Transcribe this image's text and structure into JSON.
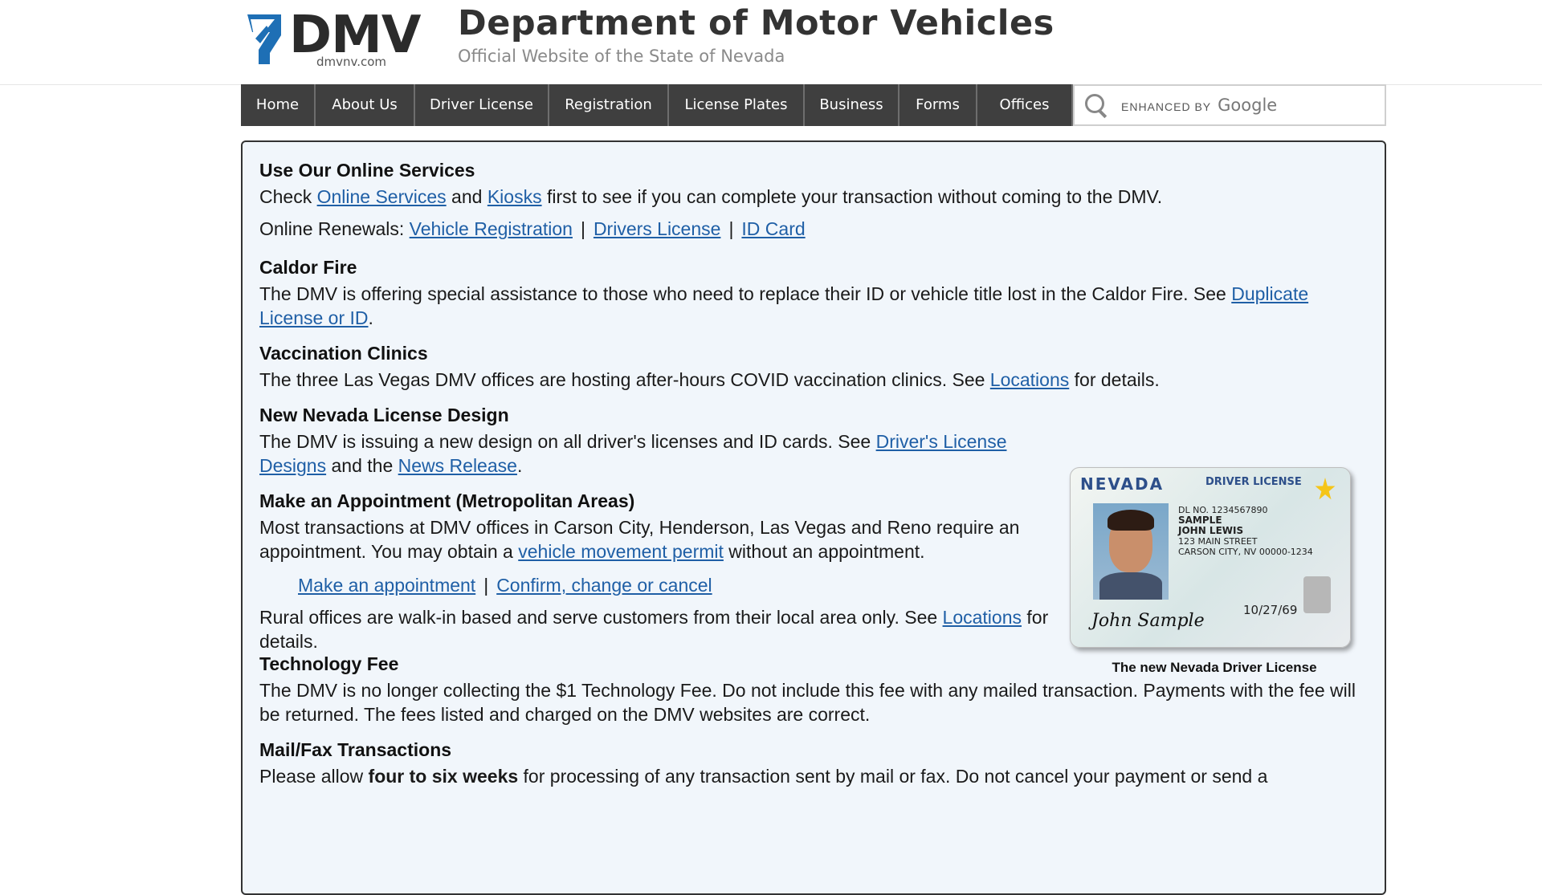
{
  "header": {
    "logo_text": "DMV",
    "logo_domain": "dmvnv.com",
    "title": "Department of Motor Vehicles",
    "subtitle": "Official Website of the State of Nevada"
  },
  "nav": {
    "items": [
      {
        "label": "Home"
      },
      {
        "label": "About Us"
      },
      {
        "label": "Driver License"
      },
      {
        "label": "Registration"
      },
      {
        "label": "License Plates"
      },
      {
        "label": "Business"
      },
      {
        "label": "Forms"
      },
      {
        "label": "Offices"
      }
    ],
    "search": {
      "enhanced_label": "ENHANCED BY",
      "brand": "Google"
    }
  },
  "content": {
    "online_services": {
      "heading": "Use Our Online Services",
      "text_before": "Check ",
      "link1": "Online Services",
      "text_mid": " and ",
      "link2": "Kiosks",
      "text_after": " first to see if you can complete your transaction without coming to the DMV."
    },
    "renewals": {
      "label": "Online Renewals: ",
      "links": [
        "Vehicle Registration",
        "Drivers License",
        "ID Card"
      ],
      "separator": "|"
    },
    "caldor": {
      "heading": "Caldor Fire",
      "text": "The DMV is offering special assistance to those who need to replace their ID or vehicle title lost in the Caldor Fire. See ",
      "link": "Duplicate License or ID",
      "end": "."
    },
    "vaccination": {
      "heading": "Vaccination Clinics",
      "text": "The three Las Vegas DMV offices are hosting after-hours COVID vaccination clinics. See ",
      "link": "Locations",
      "end": " for details."
    },
    "new_design": {
      "heading": "New Nevada License Design",
      "text": "The DMV is issuing a new design on all driver's licenses and ID cards. See ",
      "link1": "Driver's License Designs",
      "mid": " and the ",
      "link2": "News Release",
      "end": "."
    },
    "appointment": {
      "heading": "Make an Appointment (Metropolitan Areas)",
      "text": "Most transactions at DMV offices in Carson City, Henderson, Las Vegas and Reno require an appointment. You may obtain a ",
      "link": "vehicle movement permit",
      "end": " without an appointment.",
      "action_links": [
        "Make an appointment",
        "Confirm, change or cancel"
      ],
      "rural_text": "Rural offices are walk-in based and serve customers from their local area only. See ",
      "rural_link": "Locations",
      "rural_end": " for details."
    },
    "tech_fee": {
      "heading": "Technology Fee",
      "text": "The DMV is no longer collecting the $1 Technology Fee. Do not include this fee with any mailed transaction. Payments with the fee will be returned. The fees listed and charged on the DMV websites are correct."
    },
    "mail_fax": {
      "heading": "Mail/Fax Transactions",
      "text_before": "Please allow ",
      "bold": "four to six weeks",
      "text_after": " for processing of any transaction sent by mail or fax. Do not cancel your payment or send a"
    },
    "license_image": {
      "state": "NEVADA",
      "type": "DRIVER LICENSE",
      "number": "DL NO. 1234567890",
      "name_line1": "SAMPLE",
      "name_line2": "JOHN LEWIS",
      "address": "123 MAIN STREET",
      "city": "CARSON CITY, NV 00000-1234",
      "date": "10/27/69",
      "signature": "John Sample",
      "caption": "The new Nevada Driver License"
    }
  }
}
